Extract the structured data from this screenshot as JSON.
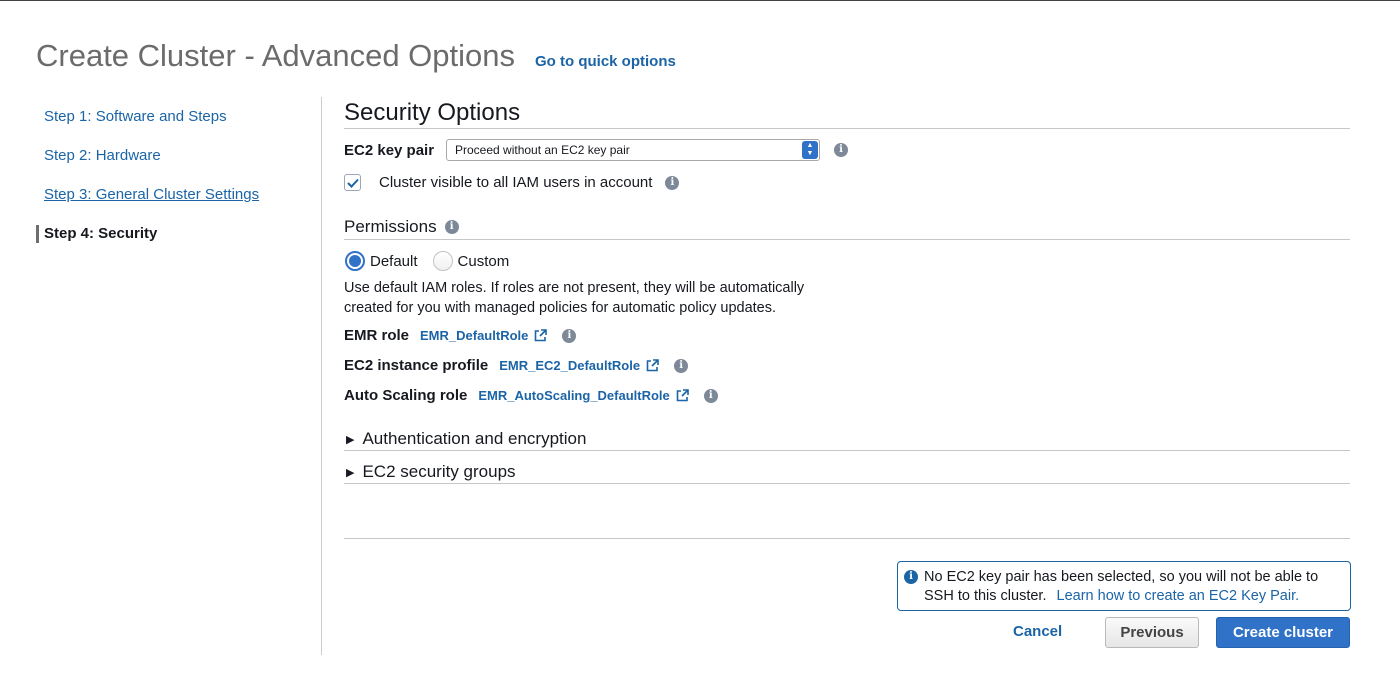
{
  "header": {
    "title": "Create Cluster - Advanced Options",
    "quick_options_link": "Go to quick options"
  },
  "steps": [
    {
      "label": "Step 1: Software and Steps"
    },
    {
      "label": "Step 2: Hardware"
    },
    {
      "label": "Step 3: General Cluster Settings"
    },
    {
      "label": "Step 4: Security"
    }
  ],
  "security": {
    "heading": "Security Options",
    "key_pair_label": "EC2 key pair",
    "key_pair_value": "Proceed without an EC2 key pair",
    "visible_checkbox_label": "Cluster visible to all IAM users in account",
    "visible_checked": true
  },
  "permissions": {
    "heading": "Permissions",
    "default_label": "Default",
    "custom_label": "Custom",
    "selected": "Default",
    "description_line1": "Use default IAM roles. If roles are not present, they will be automatically",
    "description_line2": "created for you with managed policies for automatic policy updates.",
    "emr_role_label": "EMR role",
    "emr_role_value": "EMR_DefaultRole",
    "instance_profile_label": "EC2 instance profile",
    "instance_profile_value": "EMR_EC2_DefaultRole",
    "autoscaling_label": "Auto Scaling role",
    "autoscaling_value": "EMR_AutoScaling_DefaultRole"
  },
  "sections": {
    "auth_encryption": "Authentication and encryption",
    "security_groups": "EC2 security groups"
  },
  "notice": {
    "text": "No EC2 key pair has been selected, so you will not be able to SSH to this cluster.",
    "link": "Learn how to create an EC2 Key Pair."
  },
  "buttons": {
    "cancel": "Cancel",
    "previous": "Previous",
    "create": "Create cluster"
  },
  "colors": {
    "accent": "#2f72c8",
    "link": "#1b64a6"
  }
}
